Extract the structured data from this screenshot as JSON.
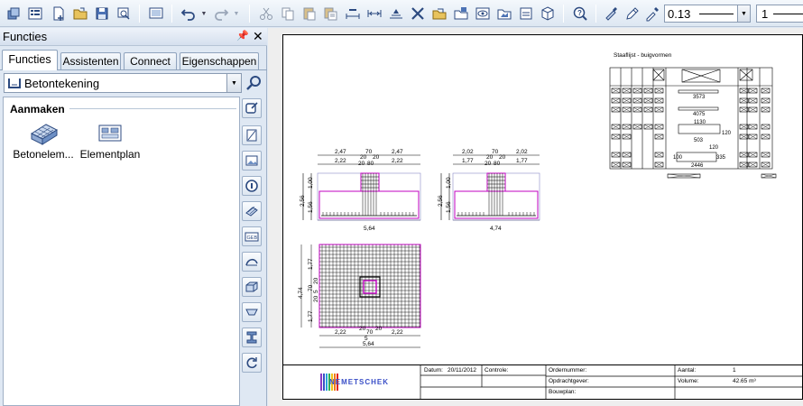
{
  "toolbar": {
    "icons": [
      "new-file",
      "open-list",
      "new-doc",
      "open-folder",
      "save",
      "print-preview",
      "screen",
      "undo",
      "redo",
      "cut",
      "copy",
      "paste",
      "paste-special",
      "dimension",
      "dimension-2",
      "tools",
      "folder-open",
      "folder-move",
      "eye",
      "folder-image",
      "layer",
      "box-3d",
      "help-search",
      "brush",
      "pencil",
      "eyedropper"
    ],
    "line_weight": "0.13",
    "line_type": "1"
  },
  "panel": {
    "title": "Functies",
    "tabs": [
      "Functies",
      "Assistenten",
      "Connect",
      "Eigenschappen"
    ],
    "active_tab": "Functies",
    "module": "Betontekening",
    "section": "Aanmaken",
    "items": [
      {
        "label": "Betonelem...",
        "icon": "concrete-element-icon"
      },
      {
        "label": "Elementplan",
        "icon": "element-plan-icon"
      }
    ]
  },
  "drawing": {
    "schedule_title": "Staaflijst - buigvormen",
    "elev1": {
      "top_dims": [
        "2,47",
        "70",
        "2,47"
      ],
      "mid_dims": [
        "2,22",
        "20",
        "20",
        "2,22"
      ],
      "mid_sub": [
        "20",
        "80"
      ],
      "left_total": "2,56",
      "left_top": "1,00",
      "left_bottom": "1,56",
      "bottom_dim": "5,64"
    },
    "elev2": {
      "top_dims": [
        "2,02",
        "70",
        "2,02"
      ],
      "mid_dims": [
        "1,77",
        "20",
        "20",
        "1,77"
      ],
      "mid_sub": [
        "20",
        "80"
      ],
      "left_total": "2,56",
      "left_top": "1,00",
      "left_bottom": "1,56",
      "bottom_dim": "4,74"
    },
    "plan": {
      "left_total": "4,74",
      "left_dims": [
        "1,77",
        "20",
        "70",
        "5",
        "20",
        "1,77"
      ],
      "bottom_dims": [
        "2,22",
        "20",
        "70",
        "5",
        "20",
        "2,22"
      ],
      "bottom_total": "5,64"
    },
    "bend_labels": [
      "3573",
      "4075",
      "1130",
      "503",
      "120",
      "120",
      "2446",
      "100",
      "335"
    ],
    "titleblock": {
      "logo": "NEMETSCHEK",
      "datum_label": "Datum:",
      "datum_value": "20/11/2012",
      "controle_label": "Controle:",
      "ordernummer_label": "Ordernummer:",
      "opdrachtgever_label": "Opdrachtgever:",
      "bouwplan_label": "Bouwplan:",
      "aantal_label": "Aantal:",
      "aantal_value": "1",
      "volume_label": "Volume:",
      "volume_value": "42.65 m³"
    }
  },
  "colors": {
    "accent": "#c000c0",
    "outline": "#8a8ac8",
    "panel_bg": "#dfe8f3"
  }
}
